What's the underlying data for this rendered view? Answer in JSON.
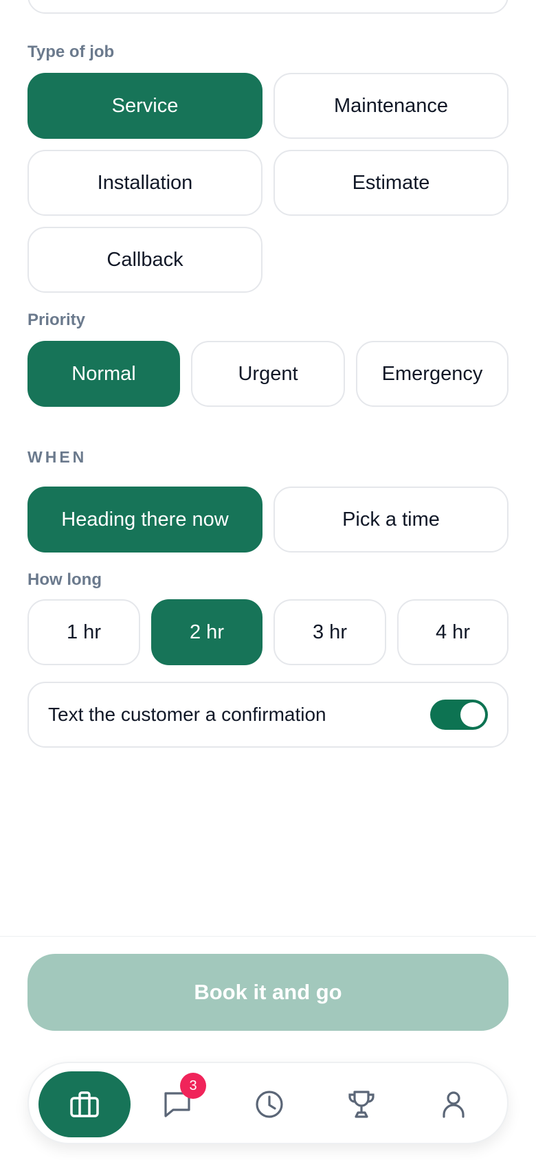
{
  "job_type": {
    "label": "Type of job",
    "options": [
      "Service",
      "Maintenance",
      "Installation",
      "Estimate",
      "Callback"
    ],
    "selected": "Service"
  },
  "priority": {
    "label": "Priority",
    "options": [
      "Normal",
      "Urgent",
      "Emergency"
    ],
    "selected": "Normal"
  },
  "when": {
    "label": "WHEN",
    "options": [
      "Heading there now",
      "Pick a time"
    ],
    "selected": "Heading there now"
  },
  "duration": {
    "label": "How long",
    "options": [
      "1 hr",
      "2 hr",
      "3 hr",
      "4 hr"
    ],
    "selected": "2 hr"
  },
  "confirmation": {
    "label": "Text the customer a confirmation",
    "enabled": true
  },
  "book_button": {
    "label": "Book it and go",
    "enabled": false
  },
  "bottom_nav": {
    "items": [
      {
        "icon": "briefcase-icon",
        "active": true
      },
      {
        "icon": "chat-icon",
        "badge": "3"
      },
      {
        "icon": "clock-icon"
      },
      {
        "icon": "trophy-icon"
      },
      {
        "icon": "person-icon"
      }
    ]
  },
  "colors": {
    "accent": "#177458",
    "disabled_button": "#a2c8bc",
    "badge": "#f0245a",
    "label": "#6b7a8d"
  }
}
